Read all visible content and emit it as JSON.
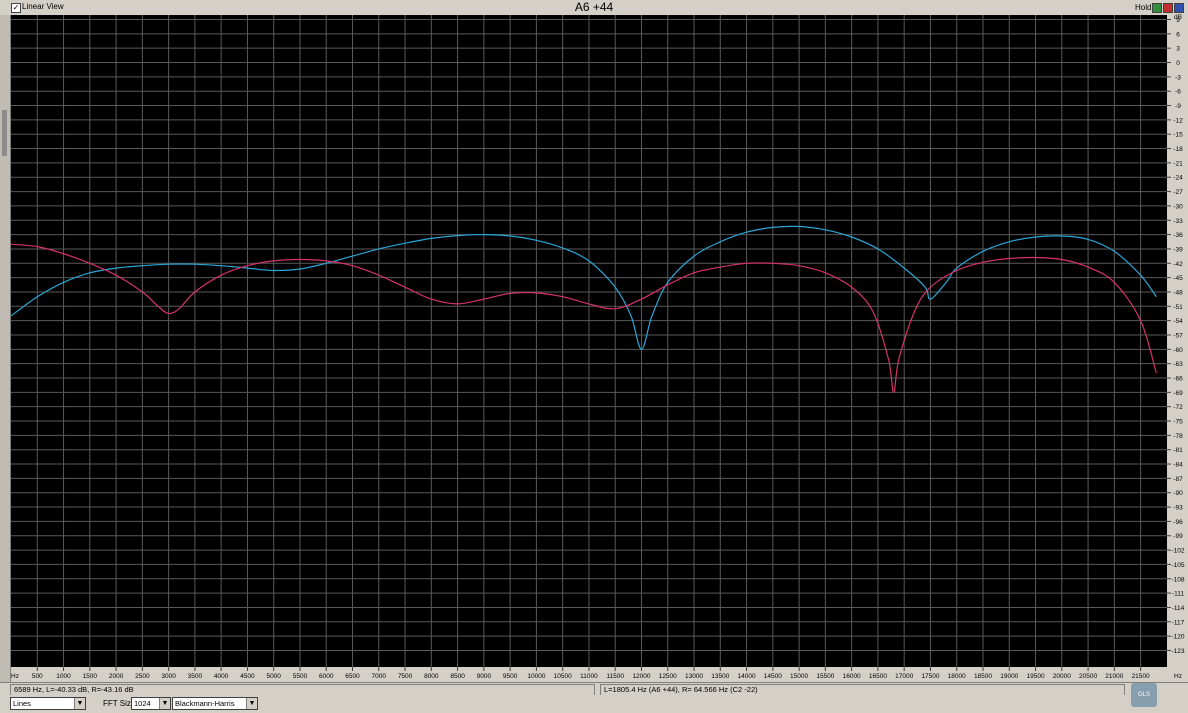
{
  "title": "A6 +44",
  "linear_view": {
    "label": "Linear View",
    "checked": true,
    "check_glyph": "✓"
  },
  "hold_label": "Hold",
  "window_buttons": [
    {
      "name": "hold-button",
      "color": "#2f8f3f",
      "glyph": ""
    },
    {
      "name": "close-button",
      "color": "#c03030",
      "glyph": ""
    },
    {
      "name": "settings-button",
      "color": "#3050b0",
      "glyph": ""
    }
  ],
  "status": {
    "left": "6589 Hz, L=-40.33 dB, R=-43.16 dB",
    "right": "L=1805.4 Hz (A6 +44), R= 64.566 Hz (C2 -22)"
  },
  "controls": {
    "mode": {
      "value": "Lines"
    },
    "fft_label": "FFT Size",
    "fft_size": {
      "value": "1024"
    },
    "window": {
      "value": "Blackmann-Harris"
    },
    "arrow_glyph": "▼"
  },
  "logo_text": "GLS",
  "chart_data": {
    "type": "line",
    "background": "#000000",
    "grid_color": "#5a5a5a",
    "x_unit_label": "Hz",
    "x_ticks": [
      500,
      1000,
      1500,
      2000,
      2500,
      3000,
      3500,
      4000,
      4500,
      5000,
      5500,
      6000,
      6500,
      7000,
      7500,
      8000,
      8500,
      9000,
      9500,
      10000,
      10500,
      11000,
      11500,
      12000,
      12500,
      13000,
      13500,
      14000,
      14500,
      15000,
      15500,
      16000,
      16500,
      17000,
      17500,
      18000,
      18500,
      19000,
      19500,
      20000,
      20500,
      21000,
      21500
    ],
    "xlim": [
      0,
      21800
    ],
    "y_unit_label": "dB",
    "y_ticks": [
      9,
      6,
      3,
      0,
      -3,
      -6,
      -9,
      -12,
      -15,
      -18,
      -21,
      -24,
      -27,
      -30,
      -33,
      -36,
      -39,
      -42,
      -45,
      -48,
      -51,
      -54,
      -57,
      -60,
      -63,
      -66,
      -69,
      -72,
      -75,
      -78,
      -81,
      -84,
      -87,
      -90,
      -93,
      -96,
      -99,
      -102,
      -105,
      -108,
      -111,
      -114,
      -117,
      -120,
      -123
    ],
    "ylim": [
      -126,
      12
    ],
    "series": [
      {
        "color": "#2aa6d6",
        "x": [
          0,
          500,
          1000,
          1500,
          2000,
          2500,
          3000,
          3500,
          4000,
          4500,
          5000,
          5500,
          6000,
          6500,
          7000,
          7500,
          8000,
          8500,
          9000,
          9500,
          10000,
          10500,
          11000,
          11500,
          11800,
          12000,
          12200,
          12500,
          13000,
          13500,
          14000,
          14500,
          15000,
          15500,
          16000,
          16500,
          17000,
          17400,
          17500,
          17800,
          18000,
          18500,
          19000,
          19500,
          20000,
          20500,
          21000,
          21500,
          21800
        ],
        "y": [
          -53,
          -49,
          -46,
          -44,
          -43,
          -42.5,
          -42.2,
          -42.2,
          -42.5,
          -43,
          -43.5,
          -43.2,
          -42,
          -40.5,
          -39,
          -37.8,
          -36.8,
          -36.2,
          -36,
          -36.3,
          -37.2,
          -38.8,
          -41.5,
          -47,
          -53,
          -60,
          -53,
          -46,
          -40.5,
          -37.5,
          -35.5,
          -34.5,
          -34.3,
          -35,
          -36.5,
          -39,
          -43,
          -47,
          -49.5,
          -46,
          -43,
          -39.5,
          -37.5,
          -36.5,
          -36.3,
          -37,
          -39.5,
          -44.5,
          -49
        ]
      },
      {
        "color": "#d6326c",
        "x": [
          0,
          500,
          1000,
          1500,
          2000,
          2500,
          2800,
          3000,
          3200,
          3500,
          4000,
          4500,
          5000,
          5500,
          6000,
          6500,
          7000,
          7500,
          8000,
          8500,
          9000,
          9500,
          10000,
          10500,
          11000,
          11500,
          12000,
          12500,
          13000,
          13500,
          14000,
          14500,
          15000,
          15500,
          16000,
          16400,
          16700,
          16800,
          16900,
          17200,
          17500,
          18000,
          18500,
          19000,
          19500,
          20000,
          20500,
          21000,
          21500,
          21800
        ],
        "y": [
          -38,
          -38.5,
          -40,
          -42,
          -44.5,
          -48,
          -51,
          -52.5,
          -51.5,
          -48,
          -44.5,
          -42.5,
          -41.5,
          -41.2,
          -41.5,
          -42.5,
          -44.5,
          -47,
          -49.5,
          -50.5,
          -49.5,
          -48.3,
          -48.2,
          -49,
          -50.5,
          -51.5,
          -49.5,
          -46.5,
          -44,
          -42.8,
          -42,
          -42,
          -42.5,
          -44,
          -47,
          -52,
          -62,
          -69,
          -62,
          -52,
          -47,
          -43.5,
          -41.8,
          -41,
          -40.8,
          -41.2,
          -42.8,
          -46,
          -54,
          -65
        ]
      }
    ]
  }
}
